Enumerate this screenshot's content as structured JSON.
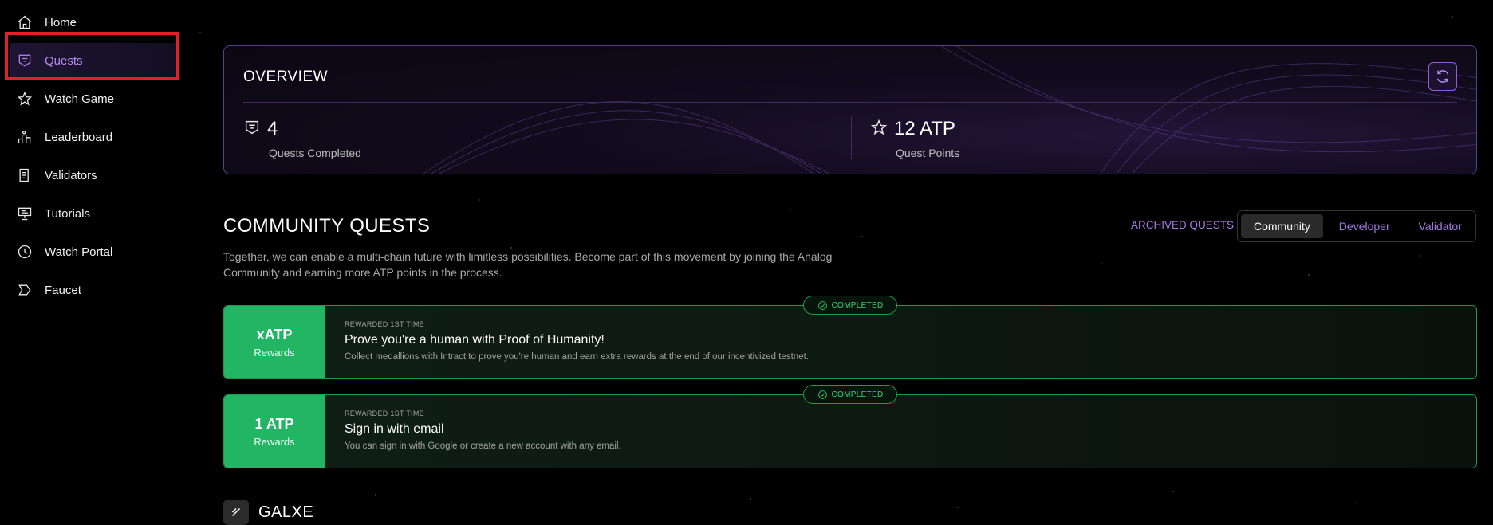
{
  "sidebar": {
    "items": [
      {
        "label": "Home",
        "icon": "home-icon"
      },
      {
        "label": "Quests",
        "icon": "quest-badge-icon",
        "active": true
      },
      {
        "label": "Watch Game",
        "icon": "star-icon"
      },
      {
        "label": "Leaderboard",
        "icon": "podium-icon"
      },
      {
        "label": "Validators",
        "icon": "document-icon"
      },
      {
        "label": "Tutorials",
        "icon": "presentation-icon"
      },
      {
        "label": "Watch Portal",
        "icon": "clock-icon"
      },
      {
        "label": "Faucet",
        "icon": "chevron-shape-icon"
      }
    ]
  },
  "overview": {
    "title": "OVERVIEW",
    "quests_completed_value": "4",
    "quests_completed_label": "Quests Completed",
    "quest_points_value": "12 ATP",
    "quest_points_label": "Quest Points"
  },
  "community": {
    "title": "COMMUNITY QUESTS",
    "description": "Together, we can enable a multi-chain future with limitless possibilities. Become part of this movement by joining the Analog Community and earning more ATP points in the process.",
    "archived_link": "ARCHIVED QUESTS",
    "tabs": [
      "Community",
      "Developer",
      "Validator"
    ],
    "active_tab": "Community"
  },
  "quests": [
    {
      "reward_value": "xATP",
      "reward_label": "Rewards",
      "tag": "REWARDED 1ST TIME",
      "title": "Prove you're a human with Proof of Humanity!",
      "description": "Collect medallions with Intract to prove you're human and earn extra rewards at the end of our incentivized testnet.",
      "status": "COMPLETED"
    },
    {
      "reward_value": "1 ATP",
      "reward_label": "Rewards",
      "tag": "REWARDED 1ST TIME",
      "title": "Sign in with email",
      "description": "You can sign in with Google or create a new account with any email.",
      "status": "COMPLETED"
    }
  ],
  "next_section": {
    "title": "GALXE"
  },
  "colors": {
    "accent_purple": "#a67be6",
    "success_green": "#22b564",
    "highlight_red": "#e3202a"
  }
}
